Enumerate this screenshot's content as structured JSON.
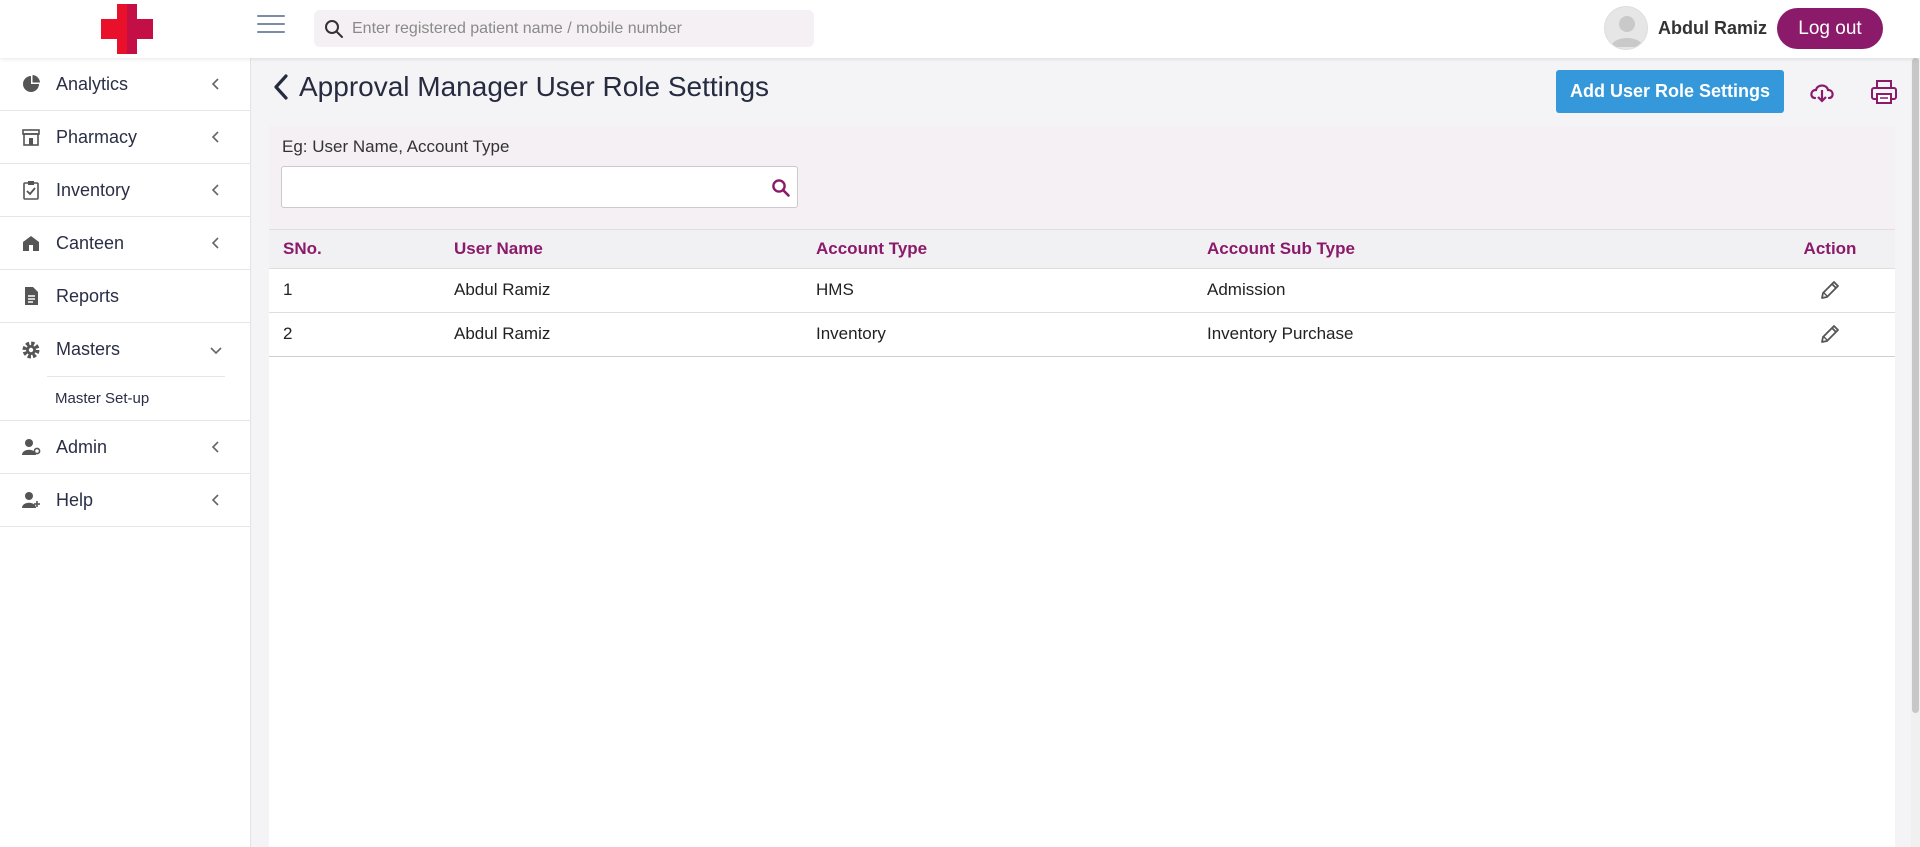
{
  "header": {
    "search_placeholder": "Enter registered patient name / mobile number",
    "user_name": "Abdul Ramiz",
    "logout_label": "Log out"
  },
  "sidebar": {
    "items": [
      {
        "label": "Analytics",
        "icon": "pie-chart-icon",
        "state": "collapsed"
      },
      {
        "label": "Pharmacy",
        "icon": "store-icon",
        "state": "collapsed"
      },
      {
        "label": "Inventory",
        "icon": "clipboard-check-icon",
        "state": "collapsed"
      },
      {
        "label": "Canteen",
        "icon": "building-icon",
        "state": "collapsed"
      },
      {
        "label": "Reports",
        "icon": "document-icon",
        "state": "none"
      },
      {
        "label": "Masters",
        "icon": "gear-icon",
        "state": "expanded"
      },
      {
        "label": "Admin",
        "icon": "user-cog-icon",
        "state": "collapsed"
      },
      {
        "label": "Help",
        "icon": "user-plus-icon",
        "state": "collapsed"
      }
    ],
    "masters_sub": {
      "label": "Master Set-up"
    }
  },
  "page": {
    "title": "Approval Manager User Role Settings",
    "add_button": "Add User Role Settings",
    "download_icon": "cloud-download-icon",
    "print_icon": "printer-icon"
  },
  "filter": {
    "label": "Eg: User Name, Account Type",
    "value": ""
  },
  "table": {
    "headers": [
      "SNo.",
      "User Name",
      "Account Type",
      "Account Sub Type",
      "Action"
    ],
    "rows": [
      [
        "1",
        "Abdul Ramiz",
        "HMS",
        "Admission"
      ],
      [
        "2",
        "Abdul Ramiz",
        "Inventory",
        "Inventory Purchase"
      ]
    ]
  },
  "colors": {
    "brand": "#8b1a6a",
    "primary_button": "#3498db",
    "logo_red": "#e8102a"
  }
}
